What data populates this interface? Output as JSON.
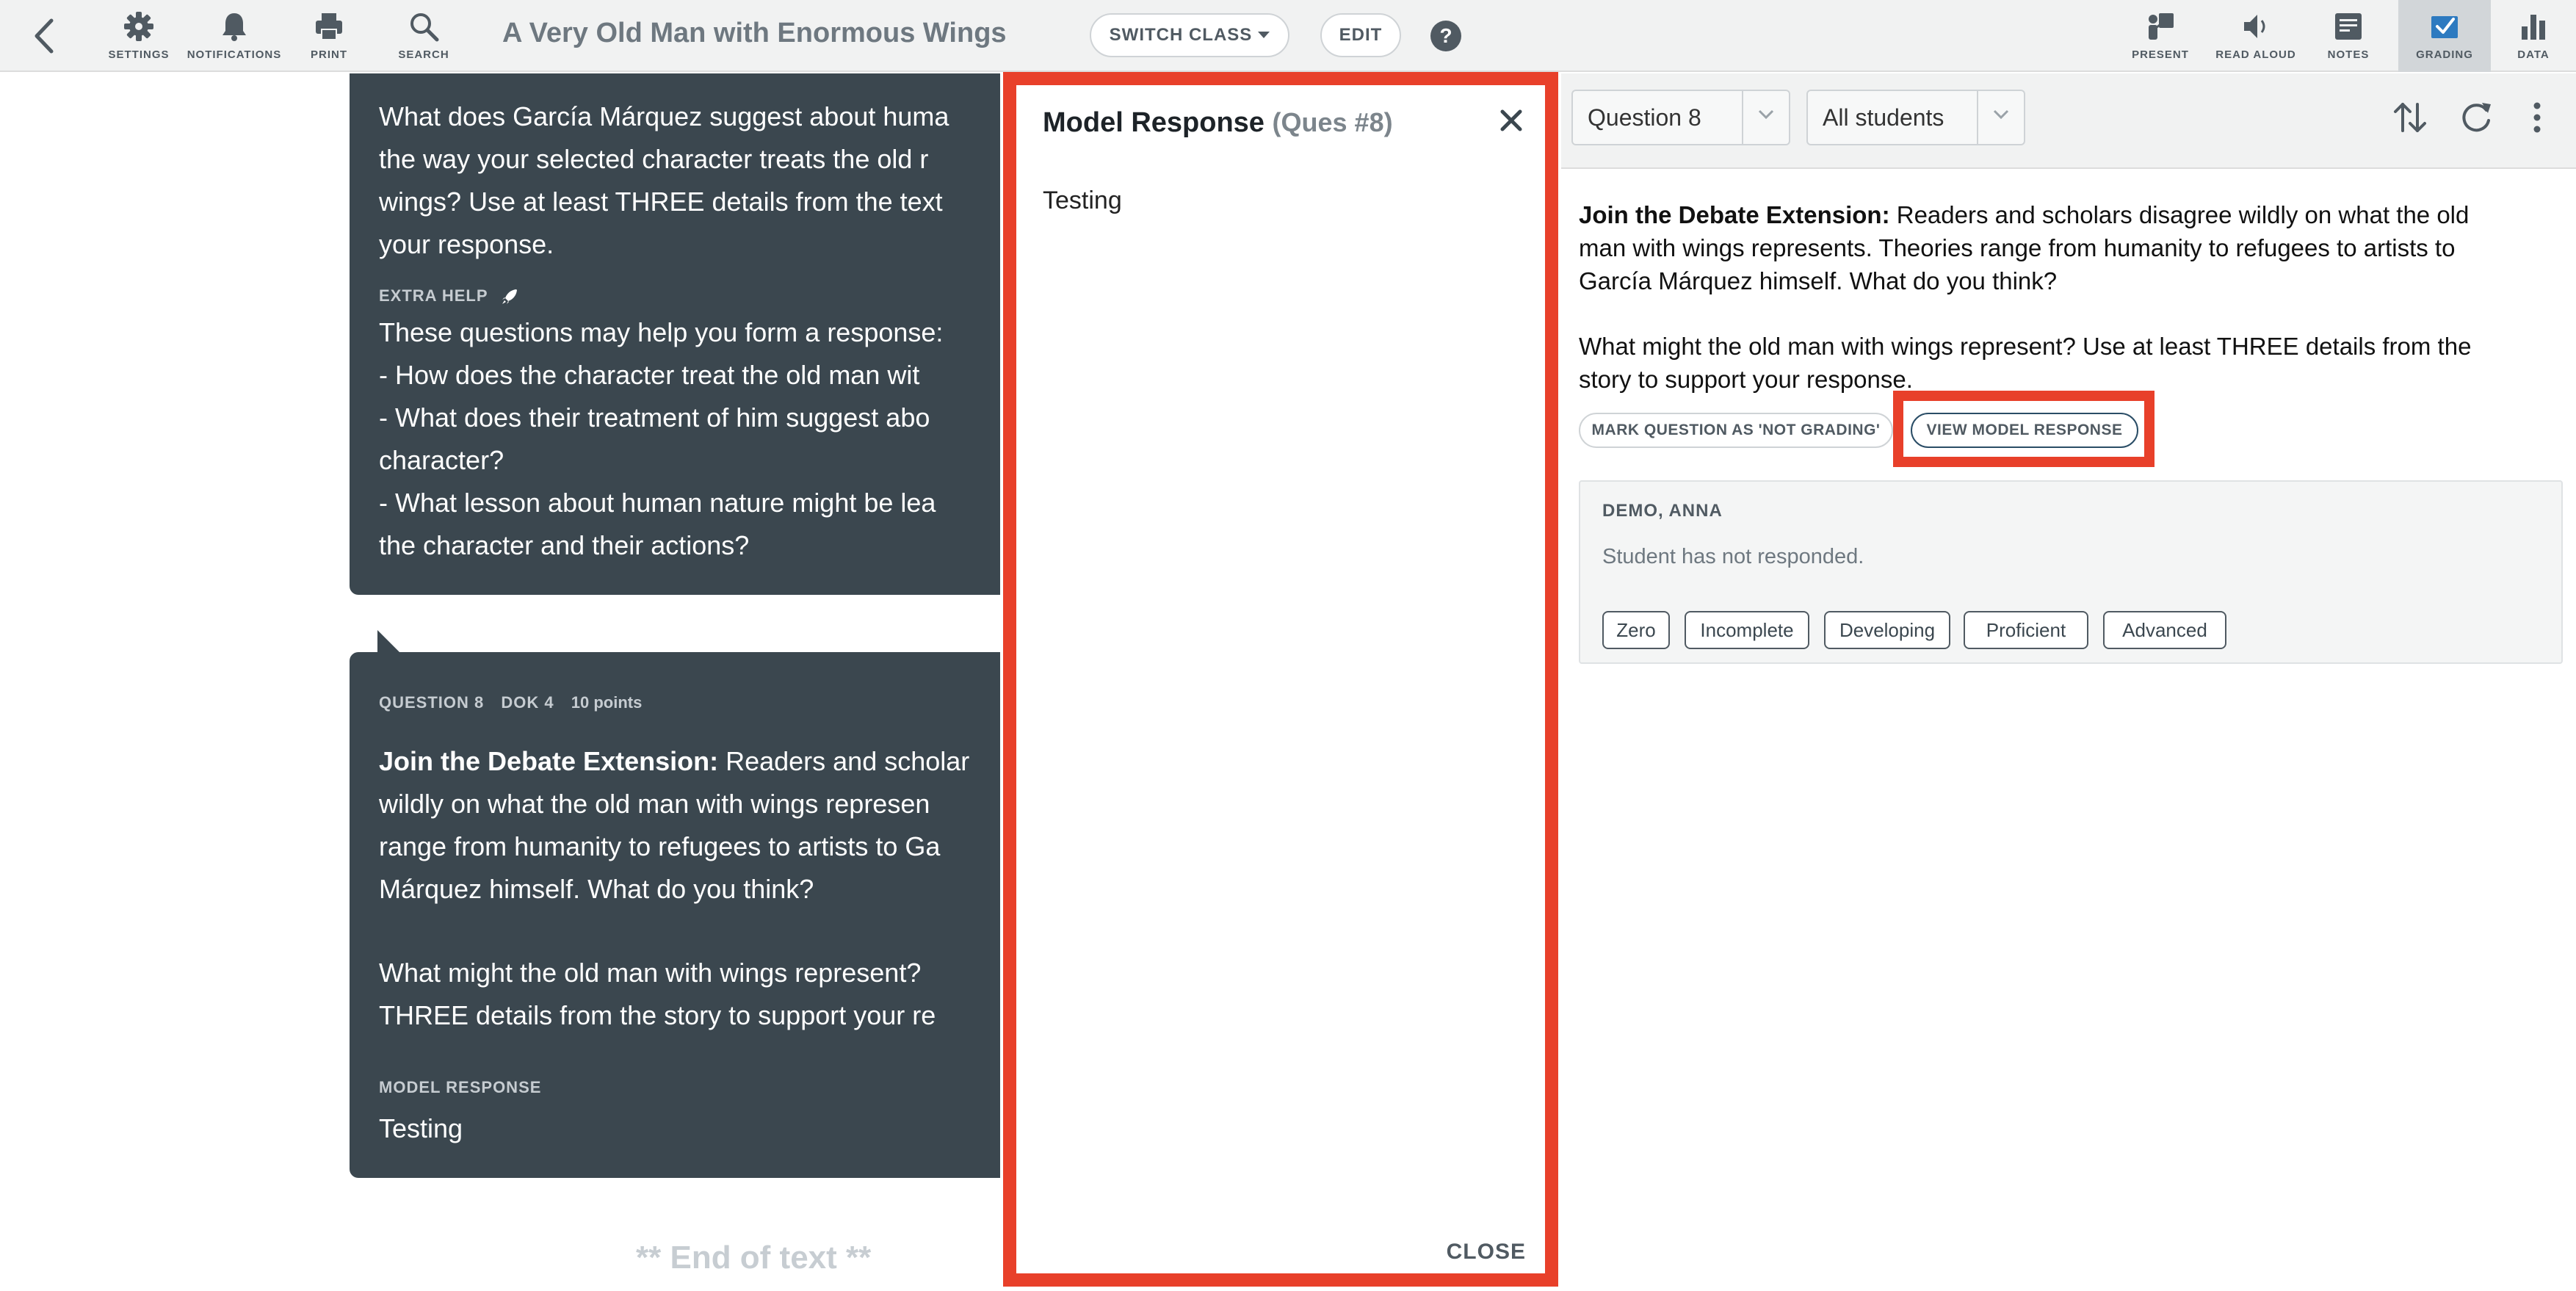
{
  "toolbar": {
    "settings": "SETTINGS",
    "notifications": "NOTIFICATIONS",
    "print": "PRINT",
    "search": "SEARCH",
    "title": "A Very Old Man with Enormous Wings",
    "switch_class": "SWITCH CLASS",
    "edit": "EDIT",
    "help": "?",
    "present": "PRESENT",
    "read_aloud": "READ ALOUD",
    "notes": "NOTES",
    "grading": "GRADING",
    "data": "DATA"
  },
  "reader": {
    "card1": {
      "lines": [
        "What does García Márquez suggest about huma",
        "the way your selected character treats the old r",
        "wings? Use at least THREE details from the text",
        "your response."
      ],
      "extra_help_label": "EXTRA HELP",
      "help_lines": [
        "These questions may help you form a response:",
        "- How does the character treat the old man wit",
        "- What does their treatment of him suggest abo",
        "character?",
        "- What lesson about human nature might be lea",
        "the character and their actions?"
      ]
    },
    "card2": {
      "question_label": "QUESTION 8",
      "dok": "DOK 4",
      "points": "10 points",
      "intro_bold": "Join the Debate Extension:",
      "line1_rest": " Readers and scholar",
      "lines": [
        "wildly on what the old man with wings represen",
        "range from humanity to refugees to artists to Ga",
        "Márquez himself. What do you think?"
      ],
      "lines2": [
        "What might the old man with wings represent?",
        "THREE details from the story to support your re"
      ],
      "model_response_label": "MODEL RESPONSE",
      "model_response": "Testing"
    },
    "end_text": "** End of text **"
  },
  "modal": {
    "title": "Model Response",
    "subtitle": "(Ques #8)",
    "body": "Testing",
    "close": "CLOSE"
  },
  "panel": {
    "question_select": "Question 8",
    "students_select": "All students",
    "question_bold": "Join the Debate Extension:",
    "question_lines": [
      " Readers and scholars disagree wildly on what the old",
      "man with wings represents. Theories range from humanity to refugees to artists to",
      "García Márquez himself. What do you think?"
    ],
    "question_lines2": [
      "What might the old man with wings represent? Use at least THREE details from the",
      "story to support your response."
    ],
    "mark_not_grading": "MARK QUESTION AS 'NOT GRADING'",
    "view_model_response": "VIEW MODEL RESPONSE",
    "student": {
      "name": "DEMO, ANNA",
      "status": "Student has not responded.",
      "grades": [
        "Zero",
        "Incomplete",
        "Developing",
        "Proficient",
        "Advanced"
      ]
    }
  },
  "colors": {
    "accent_red": "#e8402a",
    "card_dark": "#3b474f",
    "grading_active_bg": "#d2d6d9",
    "grading_icon": "#2d7ac0"
  }
}
